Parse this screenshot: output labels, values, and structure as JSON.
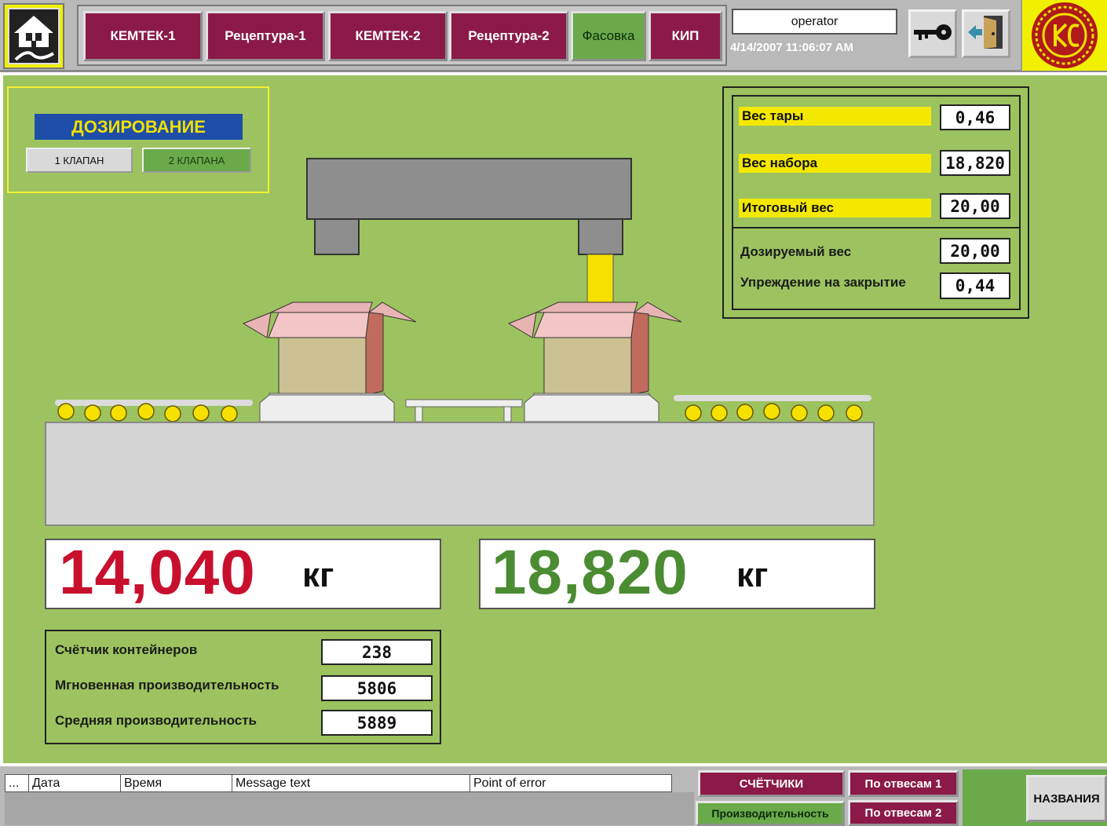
{
  "nav": {
    "buttons": [
      {
        "label": "КЕМТЕК-1"
      },
      {
        "label": "Рецептура-1"
      },
      {
        "label": "КЕМТЕК-2"
      },
      {
        "label": "Рецептура-2"
      },
      {
        "label": "Фасовка"
      },
      {
        "label": "КИП"
      }
    ],
    "active": "Фасовка",
    "user": "operator",
    "datetime": "4/14/2007 11:06:07 AM",
    "icons": [
      "home-icon",
      "key-icon",
      "exit-door-icon",
      "company-logo"
    ]
  },
  "dosing": {
    "title": "ДОЗИРОВАНИЕ",
    "valve1_label": "1 КЛАПАН",
    "valve2_label": "2 КЛАПАНА",
    "selected": "2 КЛАПАНА"
  },
  "weights": {
    "tare_label": "Вес тары",
    "tare_value": "0,46",
    "fill_label": "Вес набора",
    "fill_value": "18,820",
    "total_label": "Итоговый вес",
    "total_value": "20,00",
    "dose_label": "Дозируемый вес",
    "dose_value": "20,00",
    "preclose_label": "Упреждение на закрытие",
    "preclose_value": "0,44"
  },
  "displays": {
    "left_value": "14,040",
    "left_unit": "кг",
    "left_color": "#c8102e",
    "right_value": "18,820",
    "right_unit": "кг",
    "right_color": "#4b8c32"
  },
  "stats": {
    "counter_label": "Счётчик контейнеров",
    "counter_value": "238",
    "instant_label": "Мгновенная производительность",
    "instant_value": "5806",
    "average_label": "Средняя производительность",
    "average_value": "5889"
  },
  "alarm_grid": {
    "columns": [
      "...",
      "Дата",
      "Время",
      "Message text",
      "Point of error"
    ]
  },
  "bottom": {
    "counters_label": "СЧЁТЧИКИ",
    "productivity_label": "Производительность",
    "by_weigher1_label": "По отвесам 1",
    "by_weigher2_label": "По отвесам 2",
    "names_label": "НАЗВАНИЯ"
  },
  "colors": {
    "background": "#9cc35f",
    "maroon": "#8b1a48",
    "button_green": "#6aaa4a",
    "label_yellow": "#f5e800",
    "title_blue": "#1f4ea8"
  }
}
